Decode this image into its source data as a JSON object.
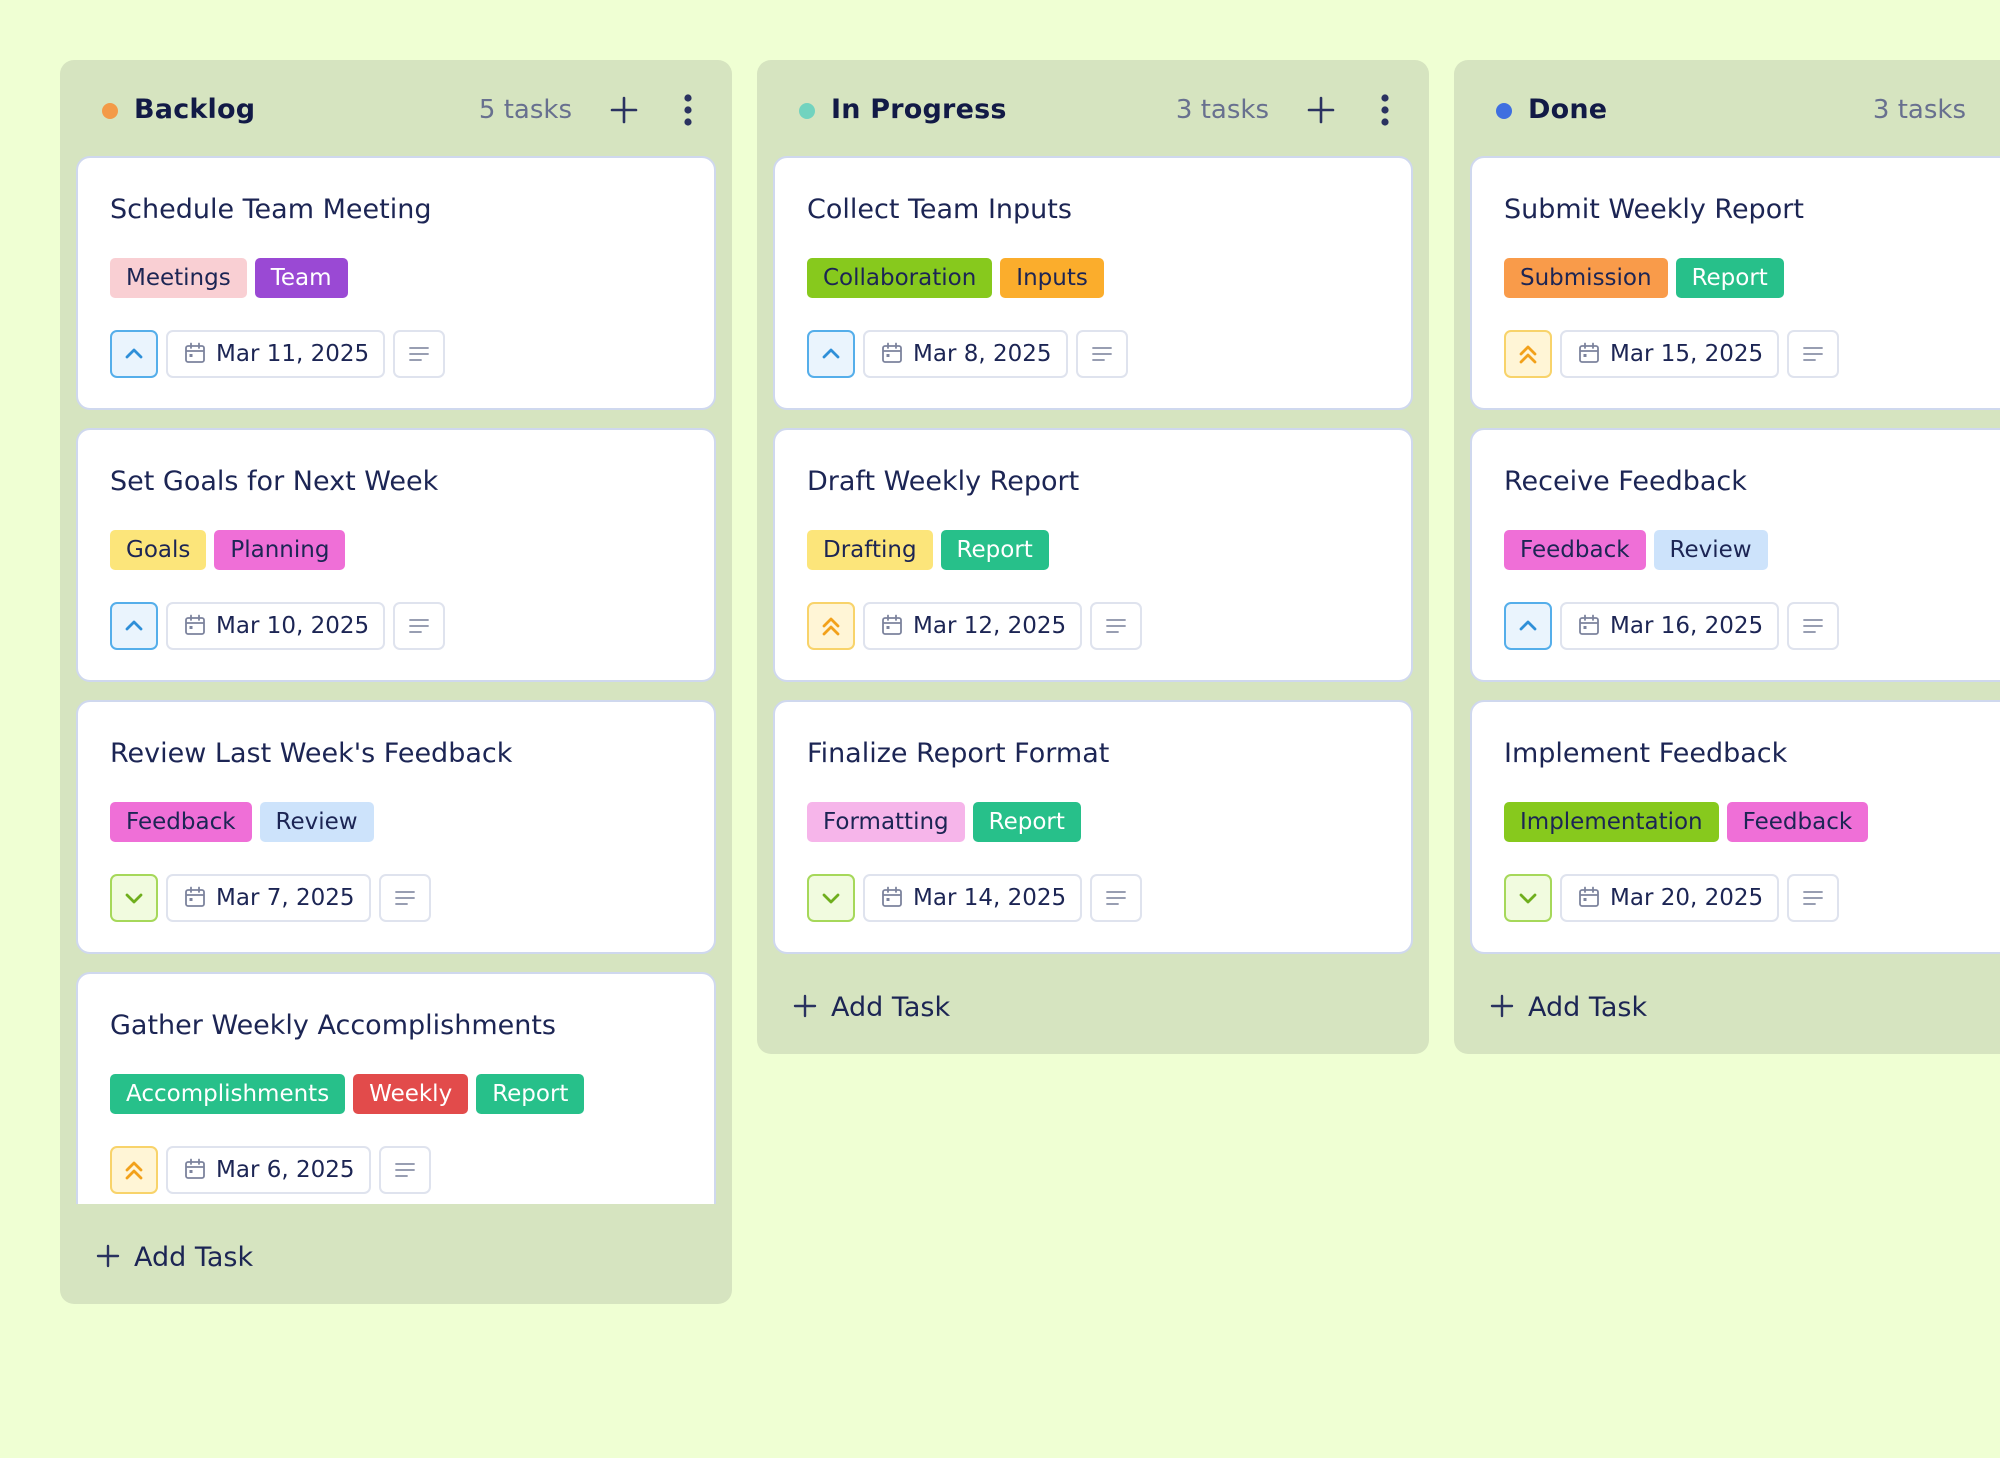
{
  "board": {
    "add_task_label": "Add Task",
    "columns": [
      {
        "id": "backlog",
        "title": "Backlog",
        "count": "5 tasks",
        "dot_color": "#f39a48",
        "cards": [
          {
            "title": "Schedule Team Meeting",
            "tags": [
              {
                "label": "Meetings",
                "bg": "#f9cfd3",
                "fg": "#1c2554"
              },
              {
                "label": "Team",
                "bg": "#9a49d4",
                "fg": "#ffffff"
              }
            ],
            "priority": "medium",
            "date": "Mar 11, 2025"
          },
          {
            "title": "Set Goals for Next Week",
            "tags": [
              {
                "label": "Goals",
                "bg": "#fce57a",
                "fg": "#1c2554"
              },
              {
                "label": "Planning",
                "bg": "#ef6fd7",
                "fg": "#1c2554"
              }
            ],
            "priority": "medium",
            "date": "Mar 10, 2025"
          },
          {
            "title": "Review Last Week's Feedback",
            "tags": [
              {
                "label": "Feedback",
                "bg": "#ef6fd7",
                "fg": "#1c2554"
              },
              {
                "label": "Review",
                "bg": "#cde3fb",
                "fg": "#1c2554"
              }
            ],
            "priority": "low",
            "date": "Mar 7, 2025"
          },
          {
            "title": "Gather Weekly Accomplishments",
            "tags": [
              {
                "label": "Accomplishments",
                "bg": "#27c08a",
                "fg": "#ffffff"
              },
              {
                "label": "Weekly",
                "bg": "#e24b4b",
                "fg": "#ffffff"
              },
              {
                "label": "Report",
                "bg": "#27c08a",
                "fg": "#ffffff"
              }
            ],
            "priority": "high",
            "date": "Mar 6, 2025"
          }
        ]
      },
      {
        "id": "in-progress",
        "title": "In Progress",
        "count": "3 tasks",
        "dot_color": "#72d3bf",
        "cards": [
          {
            "title": "Collect Team Inputs",
            "tags": [
              {
                "label": "Collaboration",
                "bg": "#87c91d",
                "fg": "#1c2554"
              },
              {
                "label": "Inputs",
                "bg": "#fbad2c",
                "fg": "#1c2554"
              }
            ],
            "priority": "medium",
            "date": "Mar 8, 2025"
          },
          {
            "title": "Draft Weekly Report",
            "tags": [
              {
                "label": "Drafting",
                "bg": "#fce57a",
                "fg": "#1c2554"
              },
              {
                "label": "Report",
                "bg": "#27c08a",
                "fg": "#ffffff"
              }
            ],
            "priority": "high",
            "date": "Mar 12, 2025"
          },
          {
            "title": "Finalize Report Format",
            "tags": [
              {
                "label": "Formatting",
                "bg": "#f6b5ea",
                "fg": "#1c2554"
              },
              {
                "label": "Report",
                "bg": "#27c08a",
                "fg": "#ffffff"
              }
            ],
            "priority": "low",
            "date": "Mar 14, 2025"
          }
        ]
      },
      {
        "id": "done",
        "title": "Done",
        "count": "3 tasks",
        "dot_color": "#3f6fe0",
        "cards": [
          {
            "title": "Submit Weekly Report",
            "tags": [
              {
                "label": "Submission",
                "bg": "#f99b4a",
                "fg": "#1c2554"
              },
              {
                "label": "Report",
                "bg": "#27c08a",
                "fg": "#ffffff"
              }
            ],
            "priority": "high",
            "date": "Mar 15, 2025"
          },
          {
            "title": "Receive Feedback",
            "tags": [
              {
                "label": "Feedback",
                "bg": "#ef6fd7",
                "fg": "#1c2554"
              },
              {
                "label": "Review",
                "bg": "#cde3fb",
                "fg": "#1c2554"
              }
            ],
            "priority": "medium",
            "date": "Mar 16, 2025"
          },
          {
            "title": "Implement Feedback",
            "tags": [
              {
                "label": "Implementation",
                "bg": "#87c91d",
                "fg": "#1c2554"
              },
              {
                "label": "Feedback",
                "bg": "#ef6fd7",
                "fg": "#1c2554"
              }
            ],
            "priority": "low",
            "date": "Mar 20, 2025"
          }
        ]
      }
    ]
  }
}
